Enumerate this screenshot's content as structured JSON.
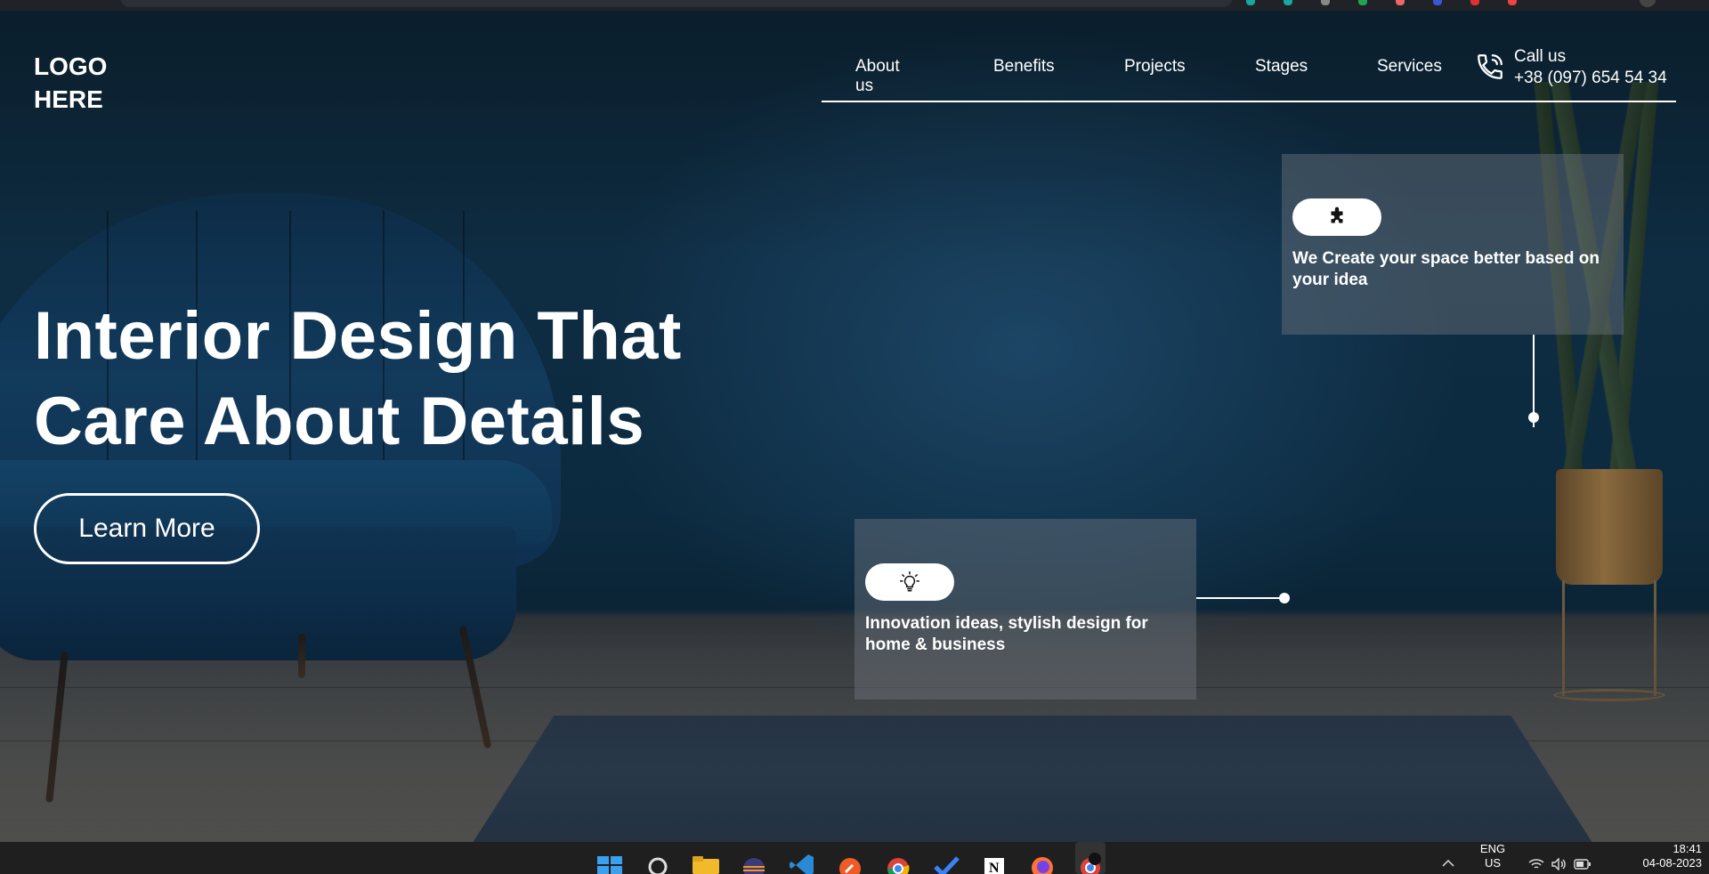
{
  "header": {
    "logo": "LOGO HERE",
    "nav": [
      "About us",
      "Benefits",
      "Projects",
      "Stages",
      "Services"
    ],
    "call_label": "Call us",
    "call_number": "+38 (097) 654 54 34"
  },
  "hero": {
    "headline_line1": "Interior Design That",
    "headline_line2": "Care About Details",
    "button_label": "Learn More"
  },
  "cards": [
    {
      "icon": "puzzle-icon",
      "text": "We Create your space better based on your idea"
    },
    {
      "icon": "lightbulb-icon",
      "text": "Innovation ideas, stylish design for home & business"
    }
  ],
  "taskbar": {
    "apps": [
      "windows-start-icon",
      "search-icon",
      "file-explorer-icon",
      "eclipse-icon",
      "vscode-icon",
      "postman-icon",
      "chrome-icon",
      "todo-icon",
      "notion-icon",
      "firefox-icon",
      "chrome-profile-icon"
    ],
    "language": "ENG",
    "region": "US",
    "time": "18:41",
    "date": "04-08-2023"
  },
  "colors": {
    "background": "#0c2a3f",
    "accent": "#ffffff",
    "card": "#6e767e"
  }
}
